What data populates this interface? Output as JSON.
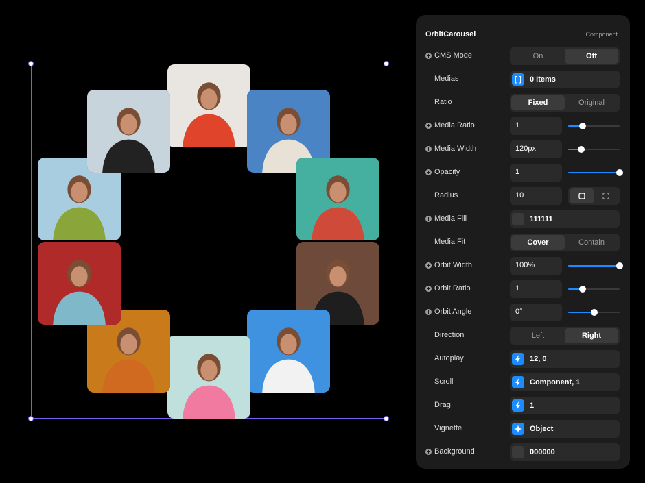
{
  "panel": {
    "title": "OrbitCarousel",
    "subtitle": "Component",
    "rows": {
      "cms_mode": {
        "label": "CMS Mode",
        "on": "On",
        "off": "Off",
        "selected": "Off"
      },
      "medias": {
        "label": "Medias",
        "badge": "[ ]",
        "value": "0 Items"
      },
      "ratio": {
        "label": "Ratio",
        "fixed": "Fixed",
        "original": "Original",
        "selected": "Fixed"
      },
      "media_ratio": {
        "label": "Media Ratio",
        "value": "1",
        "level": 0.28
      },
      "media_width": {
        "label": "Media Width",
        "value": "120px",
        "level": 0.25
      },
      "opacity": {
        "label": "Opacity",
        "value": "1",
        "level": 1.0
      },
      "radius": {
        "label": "Radius",
        "value": "10"
      },
      "media_fill": {
        "label": "Media Fill",
        "value": "111111",
        "color": "#111111"
      },
      "media_fit": {
        "label": "Media Fit",
        "cover": "Cover",
        "contain": "Contain",
        "selected": "Cover"
      },
      "orbit_width": {
        "label": "Orbit Width",
        "value": "100%",
        "level": 1.0
      },
      "orbit_ratio": {
        "label": "Orbit Ratio",
        "value": "1",
        "level": 0.28
      },
      "orbit_angle": {
        "label": "Orbit Angle",
        "value": "0°",
        "level": 0.5
      },
      "direction": {
        "label": "Direction",
        "left": "Left",
        "right": "Right",
        "selected": "Right"
      },
      "autoplay": {
        "label": "Autoplay",
        "icon": "lightning-icon",
        "value": "12, 0"
      },
      "scroll": {
        "label": "Scroll",
        "icon": "lightning-icon",
        "value": "Component, 1"
      },
      "drag": {
        "label": "Drag",
        "icon": "lightning-icon",
        "value": "1"
      },
      "vignette": {
        "label": "Vignette",
        "icon": "sparkle-icon",
        "value": "Object"
      },
      "background": {
        "label": "Background",
        "value": "000000",
        "color": "#000000"
      }
    }
  },
  "colors": {
    "accent": "#1a8cff",
    "selection": "#7b5cf0",
    "panel_bg": "#1c1c1c",
    "control_bg": "#2a2a2a"
  },
  "carousel": {
    "photos": [
      {
        "name": "photo-woman-red-sweater",
        "bg": "#e9e6e1",
        "fg": "#e0452b"
      },
      {
        "name": "photo-woman-blue-wall",
        "bg": "#4a84c4",
        "fg": "#e7e1d6"
      },
      {
        "name": "photo-woman-striped-shirt",
        "bg": "#46b0a0",
        "fg": "#d04a3a"
      },
      {
        "name": "photo-woman-curly-hair-stairs",
        "bg": "#6e4a3a",
        "fg": "#1e1e1e"
      },
      {
        "name": "photo-woman-sunglasses-sky",
        "bg": "#3f92e0",
        "fg": "#f2f2f2"
      },
      {
        "name": "photo-woman-pink-top",
        "bg": "#bfe0dc",
        "fg": "#f07aa0"
      },
      {
        "name": "photo-woman-orange-cafe",
        "bg": "#c97a1a",
        "fg": "#d06a20"
      },
      {
        "name": "photo-woman-red-beanie",
        "bg": "#b12a2a",
        "fg": "#7fb8c8"
      },
      {
        "name": "photo-woman-green-sweater",
        "bg": "#a9cde0",
        "fg": "#8aa63a"
      },
      {
        "name": "photo-woman-black-sweater",
        "bg": "#c8d4dc",
        "fg": "#222222"
      }
    ]
  }
}
